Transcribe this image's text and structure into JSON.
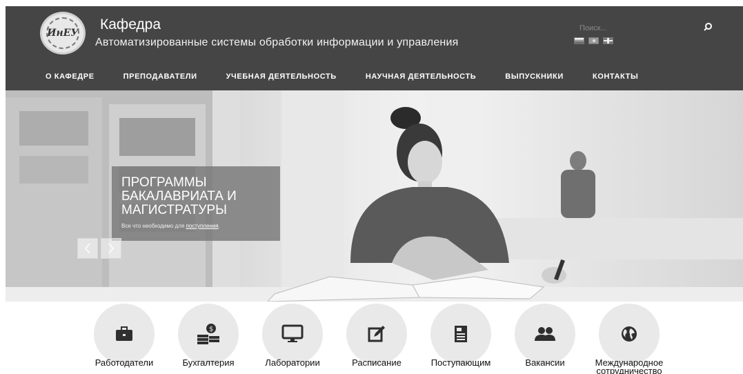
{
  "header": {
    "title": "Кафедра",
    "subtitle": "Автоматизированные системы обработки информации и управления",
    "logo_text": "ИнЕУ",
    "search": {
      "placeholder": "Поиск..."
    },
    "languages": [
      "ru",
      "kz",
      "en"
    ]
  },
  "nav": {
    "items": [
      {
        "label": "О КАФЕДРЕ"
      },
      {
        "label": "ПРЕПОДАВАТЕЛИ"
      },
      {
        "label": "УЧЕБНАЯ ДЕЯТЕЛЬНОСТЬ"
      },
      {
        "label": "НАУЧНАЯ ДЕЯТЕЛЬНОСТЬ"
      },
      {
        "label": "ВЫПУСКНИКИ"
      },
      {
        "label": "КОНТАКТЫ"
      }
    ]
  },
  "slider": {
    "title_line1": "ПРОГРАММЫ",
    "title_line2": "БАКАЛАВРИАТА И",
    "title_line3": "МАГИСТРАТУРЫ",
    "desc_text": "Все что необходимо для ",
    "desc_link": "поступления",
    "desc_end": "."
  },
  "quick_links": [
    {
      "label": "Работодатели",
      "icon": "briefcase-icon"
    },
    {
      "label": "Бухгалтерия",
      "icon": "money-icon"
    },
    {
      "label": "Лаборатории",
      "icon": "monitor-icon"
    },
    {
      "label": "Расписание",
      "icon": "edit-icon"
    },
    {
      "label": "Поступающим",
      "icon": "document-icon"
    },
    {
      "label": "Вакансии",
      "icon": "users-icon"
    },
    {
      "label": "Международное сотрудничество",
      "icon": "globe-icon"
    }
  ],
  "colors": {
    "header_bg": "#454545",
    "circle_bg": "#e9e9e9"
  }
}
